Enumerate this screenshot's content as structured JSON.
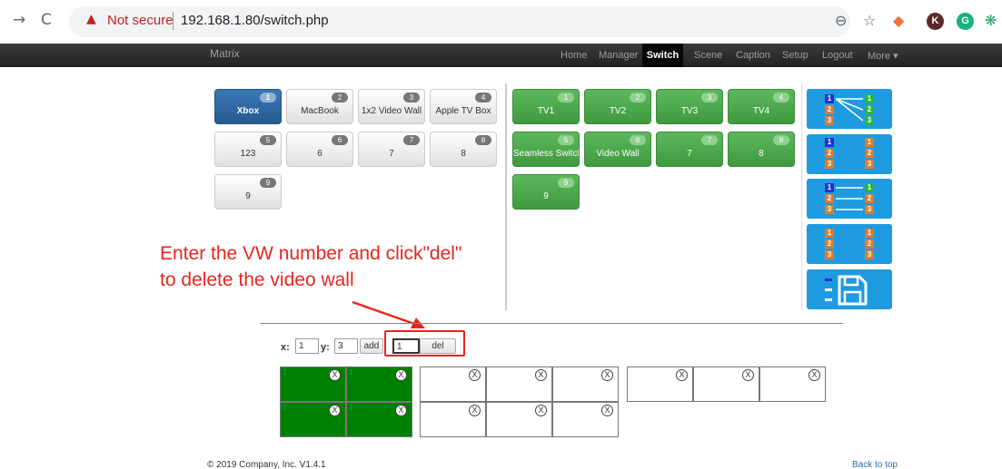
{
  "browser": {
    "security_label": "Not secure",
    "url": "192.168.1.80/switch.php",
    "ext_k": "K",
    "ext_g": "G"
  },
  "navbar": {
    "brand": "Matrix",
    "items": [
      "Home",
      "Manager",
      "Switch",
      "Scene",
      "Caption",
      "Setup",
      "Logout",
      "More ▾"
    ],
    "active": "Switch"
  },
  "inputs": [
    {
      "num": "1",
      "label": "Xbox",
      "active": true
    },
    {
      "num": "2",
      "label": "MacBook"
    },
    {
      "num": "3",
      "label": "1x2 Video Wall"
    },
    {
      "num": "4",
      "label": "Apple TV Box"
    },
    {
      "num": "5",
      "label": "123"
    },
    {
      "num": "6",
      "label": "6"
    },
    {
      "num": "7",
      "label": "7"
    },
    {
      "num": "8",
      "label": "8"
    },
    {
      "num": "9",
      "label": "9"
    }
  ],
  "outputs": [
    {
      "num": "1",
      "label": "TV1"
    },
    {
      "num": "2",
      "label": "TV2"
    },
    {
      "num": "3",
      "label": "TV3"
    },
    {
      "num": "4",
      "label": "TV4"
    },
    {
      "num": "5",
      "label": "Seamless Switch"
    },
    {
      "num": "6",
      "label": "Video Wall"
    },
    {
      "num": "7",
      "label": "7"
    },
    {
      "num": "8",
      "label": "8"
    },
    {
      "num": "9",
      "label": "9"
    }
  ],
  "scenes": {
    "numbers": [
      "1",
      "2",
      "3"
    ]
  },
  "annotation": {
    "line1": "Enter the VW number and click\"del\"",
    "line2": "to delete the video wall"
  },
  "form": {
    "x_label": "x:",
    "x_value": "1",
    "y_label": "y:",
    "y_value": "3",
    "add_label": "add",
    "del_value": "1",
    "del_label": "del"
  },
  "wall": {
    "close_glyph": "X",
    "cell_index": "1"
  },
  "footer": {
    "copyright": "© 2019 Company, Inc. V1.4.1",
    "back_to_top": "Back to top"
  }
}
